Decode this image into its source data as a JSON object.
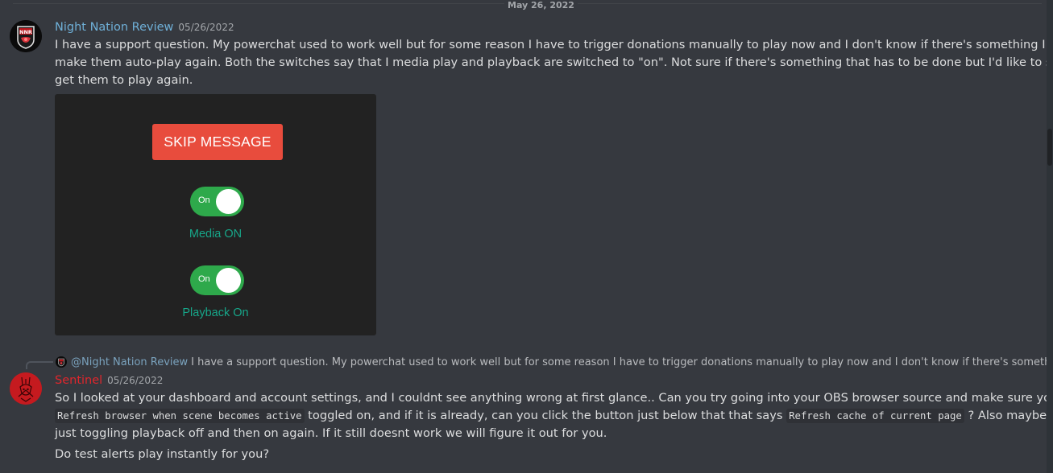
{
  "date_divider": "May 26, 2022",
  "messages": [
    {
      "author": "Night Nation Review",
      "author_color": "#6fb0d8",
      "timestamp": "05/26/2022",
      "avatar_icon": "nnr-shield-logo-icon",
      "lines": [
        "I have a support question.  My powerchat used to work well but for some reason I have to trigger donations manually to play now and I don't know if there's something I can do to",
        "make them auto-play again.  Both the switches say that I media play and playback are switched to \"on\".  Not sure if there's something that has to be done but I'd like to see if I can",
        "get them to play again."
      ],
      "attachment": {
        "skip_button": "SKIP MESSAGE",
        "toggles": [
          {
            "state_label": "On",
            "caption": "Media ON",
            "on": true
          },
          {
            "state_label": "On",
            "caption": "Playback On",
            "on": true
          }
        ],
        "colors": {
          "background": "#222222",
          "skip_button": "#e84c3d",
          "toggle_on": "#2ea94b",
          "caption": "#17a689"
        }
      }
    },
    {
      "author": "Sentinel",
      "author_color": "#e0262c",
      "timestamp": "05/26/2022",
      "avatar_icon": "sentinel-red-logo-icon",
      "reply": {
        "mention": "@Night Nation Review",
        "preview": "I have a support question.  My powerchat used to work well but for some reason I have to trigger donations manually to play now and I don't know if there's something I can do t..."
      },
      "line1": "So I looked at your dashboard and account settings, and I couldnt see anything wrong at first glance.. Can you try going into your OBS browser source and make sure you have",
      "line2_code1": "Refresh browser when scene becomes active",
      "line2_mid": " toggled on, and if it is already, can you click the button just below that that says ",
      "line2_code2": "Refresh cache of current page",
      "line2_end": " ? Also maybe try",
      "line3": "just toggling playback off and then on again. If it still doesnt work we will figure it out for you.",
      "line4": "Do test alerts play instantly for you?"
    }
  ]
}
